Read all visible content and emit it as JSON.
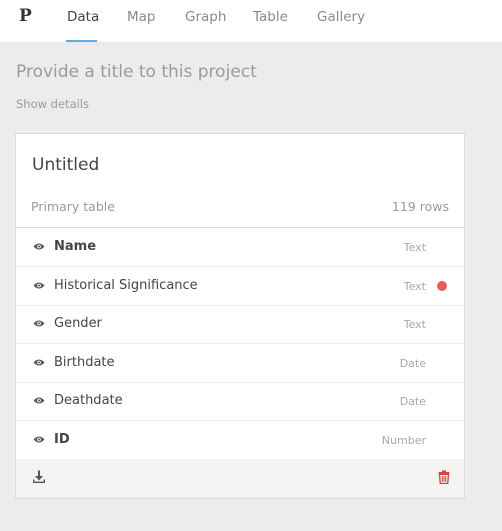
{
  "header": {
    "logo": "P",
    "tabs": [
      {
        "label": "Data",
        "active": true
      },
      {
        "label": "Map"
      },
      {
        "label": "Graph"
      },
      {
        "label": "Table"
      },
      {
        "label": "Gallery"
      }
    ]
  },
  "project": {
    "title_placeholder": "Provide a title to this project",
    "show_details": "Show details"
  },
  "card": {
    "title": "Untitled",
    "primary_label": "Primary table",
    "rows_count": "119 rows",
    "fields": [
      {
        "name": "Name",
        "type": "Text",
        "bold": true
      },
      {
        "name": "Historical Significance",
        "type": "Text",
        "flag": true
      },
      {
        "name": "Gender",
        "type": "Text"
      },
      {
        "name": "Birthdate",
        "type": "Date"
      },
      {
        "name": "Deathdate",
        "type": "Date"
      },
      {
        "name": "ID",
        "type": "Number",
        "bold": true
      }
    ]
  },
  "colors": {
    "accent": "#5aaee0",
    "flag_dot": "#e55a5a",
    "delete": "#c9403b",
    "icon": "#555555"
  },
  "icons": {
    "visibility": "eye-icon",
    "download": "download-icon",
    "delete": "trash-icon"
  }
}
